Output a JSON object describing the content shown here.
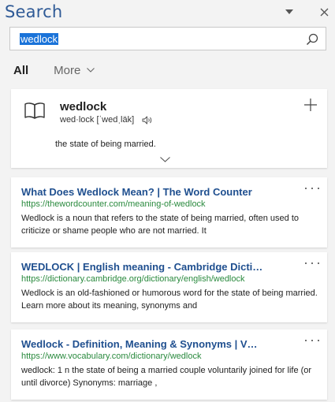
{
  "pane": {
    "title": "Search"
  },
  "search": {
    "value": "wedlock"
  },
  "tabs": {
    "all_label": "All",
    "more_label": "More"
  },
  "definition": {
    "word": "wedlock",
    "pronunciation": "wed·lock [ˈwedˌläk]",
    "text": "the state of being married."
  },
  "results": [
    {
      "title": "What Does Wedlock Mean? | The Word Counter",
      "url": "https://thewordcounter.com/meaning-of-wedlock",
      "snippet": "Wedlock is a noun that refers to the state of being married, often used to criticize or shame people who are not married. It"
    },
    {
      "title": "WEDLOCK | English meaning - Cambridge Dicti…",
      "url": "https://dictionary.cambridge.org/dictionary/english/wedlock",
      "snippet": "Wedlock is an old-fashioned or humorous word for the state of being married. Learn more about its meaning, synonyms and"
    },
    {
      "title": "Wedlock - Definition, Meaning & Synonyms | V…",
      "url": "https://www.vocabulary.com/dictionary/wedlock",
      "snippet": "wedlock: 1 n the state of being a married couple voluntarily joined for life (or until divorce) Synonyms: marriage ,"
    }
  ],
  "colors": {
    "title_blue": "#2f5a96",
    "link_blue": "#1f4f8f",
    "url_green": "#2a8a3e",
    "selection_blue": "#1a73d9"
  },
  "icons": {
    "menu": "chevron-down-icon",
    "close": "close-icon",
    "search": "search-icon",
    "more_tab": "chevron-down-icon",
    "dictionary": "book-icon",
    "audio": "speaker-icon",
    "add": "plus-icon",
    "expand": "chevron-down-icon",
    "result_more": "more-dots-icon"
  }
}
